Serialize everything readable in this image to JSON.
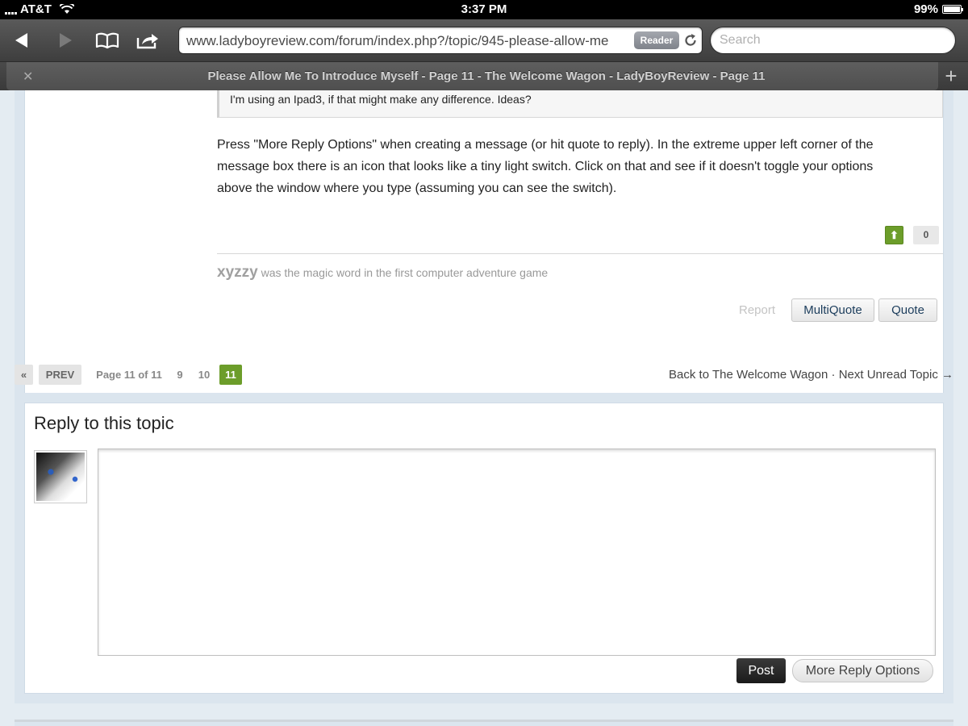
{
  "status_bar": {
    "carrier": "AT&T",
    "time": "3:37 PM",
    "battery": "99%",
    "battery_level": 0.99
  },
  "browser": {
    "url": "www.ladyboyreview.com/forum/index.php?/topic/945-please-allow-me",
    "reader_label": "Reader",
    "search_placeholder": "Search",
    "tab_title": "Please Allow Me To Introduce Myself - Page 11 - The Welcome Wagon - LadyBoyReview - Page 11"
  },
  "post": {
    "quote_text": "I'm using an Ipad3, if that might make any difference. Ideas?",
    "body_lines": [
      "Press \"More Reply Options\" when creating a message (or hit quote to reply). In the extreme upper left corner of the",
      "message box there is an icon that looks like a tiny light switch. Click on that and see if it doesn't toggle your options",
      "above the window where you type (assuming you can see the switch)."
    ],
    "reputation": "0",
    "signature_word": "xyzzy",
    "signature_rest": " was the magic word in the first computer adventure game",
    "report_label": "Report",
    "multiquote_label": "MultiQuote",
    "quote_label": "Quote"
  },
  "pagination": {
    "first": "«",
    "prev": "PREV",
    "page_info": "Page 11 of 11",
    "pages": [
      "9",
      "10",
      "11"
    ],
    "current_page": "11",
    "back_link": "Back to The Welcome Wagon",
    "separator": "·",
    "next_unread": "Next Unread Topic →"
  },
  "reply": {
    "title": "Reply to this topic",
    "post_label": "Post",
    "more_options_label": "More Reply Options"
  }
}
